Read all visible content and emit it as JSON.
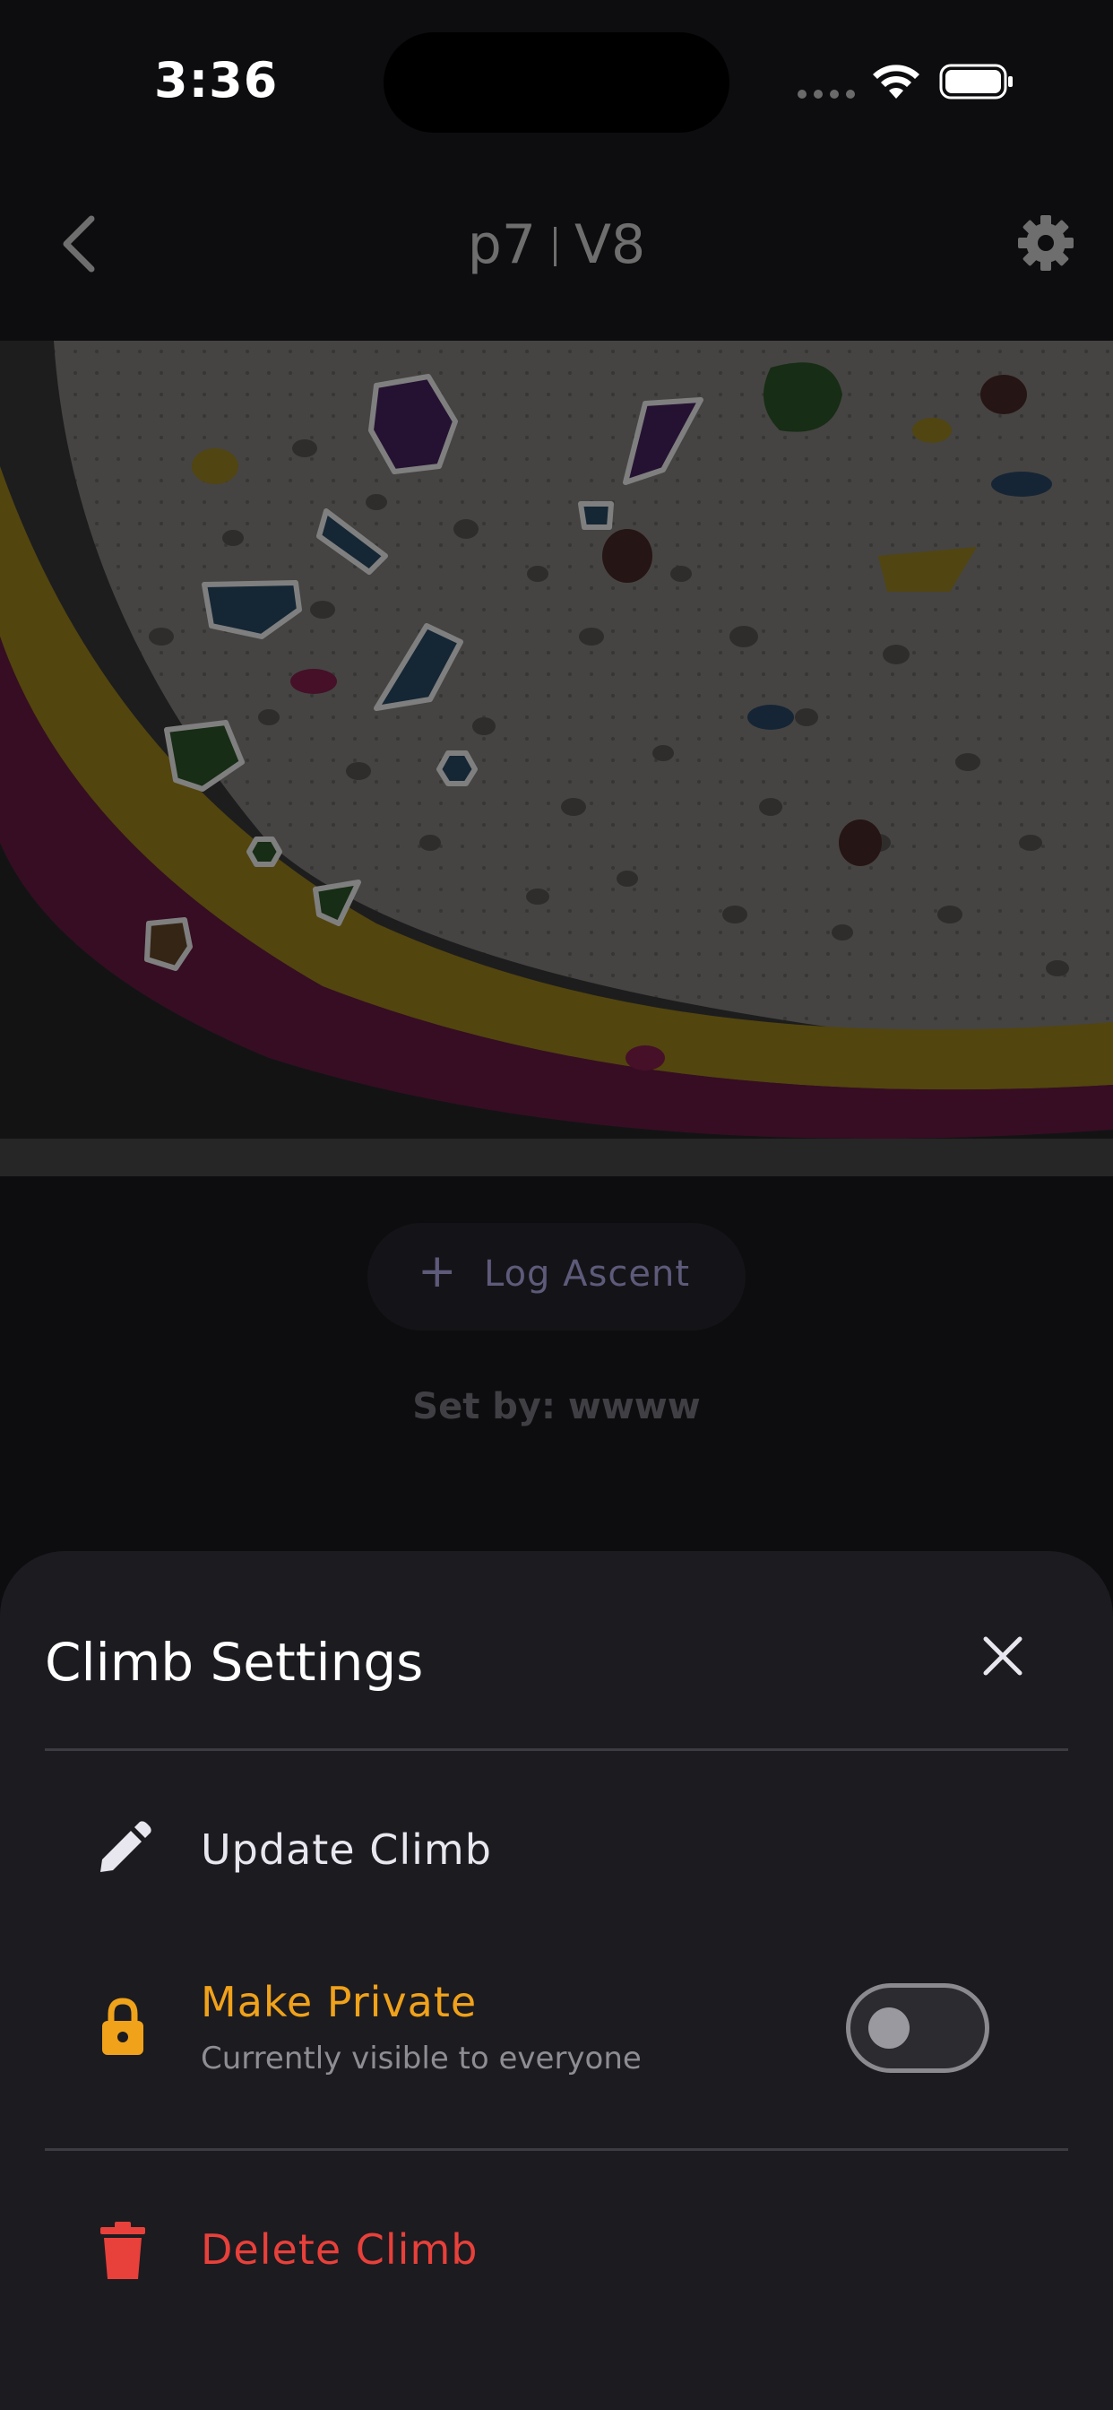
{
  "status_bar": {
    "time": "3:36",
    "icons": [
      "cellular-signal-icon",
      "wifi-icon",
      "battery-icon"
    ]
  },
  "nav": {
    "back_icon": "chevron-left-icon",
    "title_name": "p7",
    "title_grade": "V8",
    "settings_icon": "gear-icon"
  },
  "climb_image": {
    "content": "climbing-wall-photo",
    "highlighted_hold_outline_color": "#ffffff"
  },
  "log_ascent": {
    "icon": "plus-icon",
    "label": "Log Ascent"
  },
  "set_by": "Set by: wwww",
  "sheet": {
    "title": "Climb Settings",
    "close_icon": "close-icon",
    "items": [
      {
        "icon": "pencil-icon",
        "label": "Update Climb",
        "color": "#e8e6ee"
      },
      {
        "icon": "lock-icon",
        "label": "Make Private",
        "subtitle": "Currently visible to everyone",
        "color": "#f0a21a",
        "toggle_on": false
      },
      {
        "icon": "trash-icon",
        "label": "Delete Climb",
        "color": "#e8403a"
      }
    ]
  },
  "colors": {
    "background": "#0d0d0f",
    "sheet": "#1c1b20",
    "accent_private": "#f0a21a",
    "danger": "#e8403a"
  }
}
